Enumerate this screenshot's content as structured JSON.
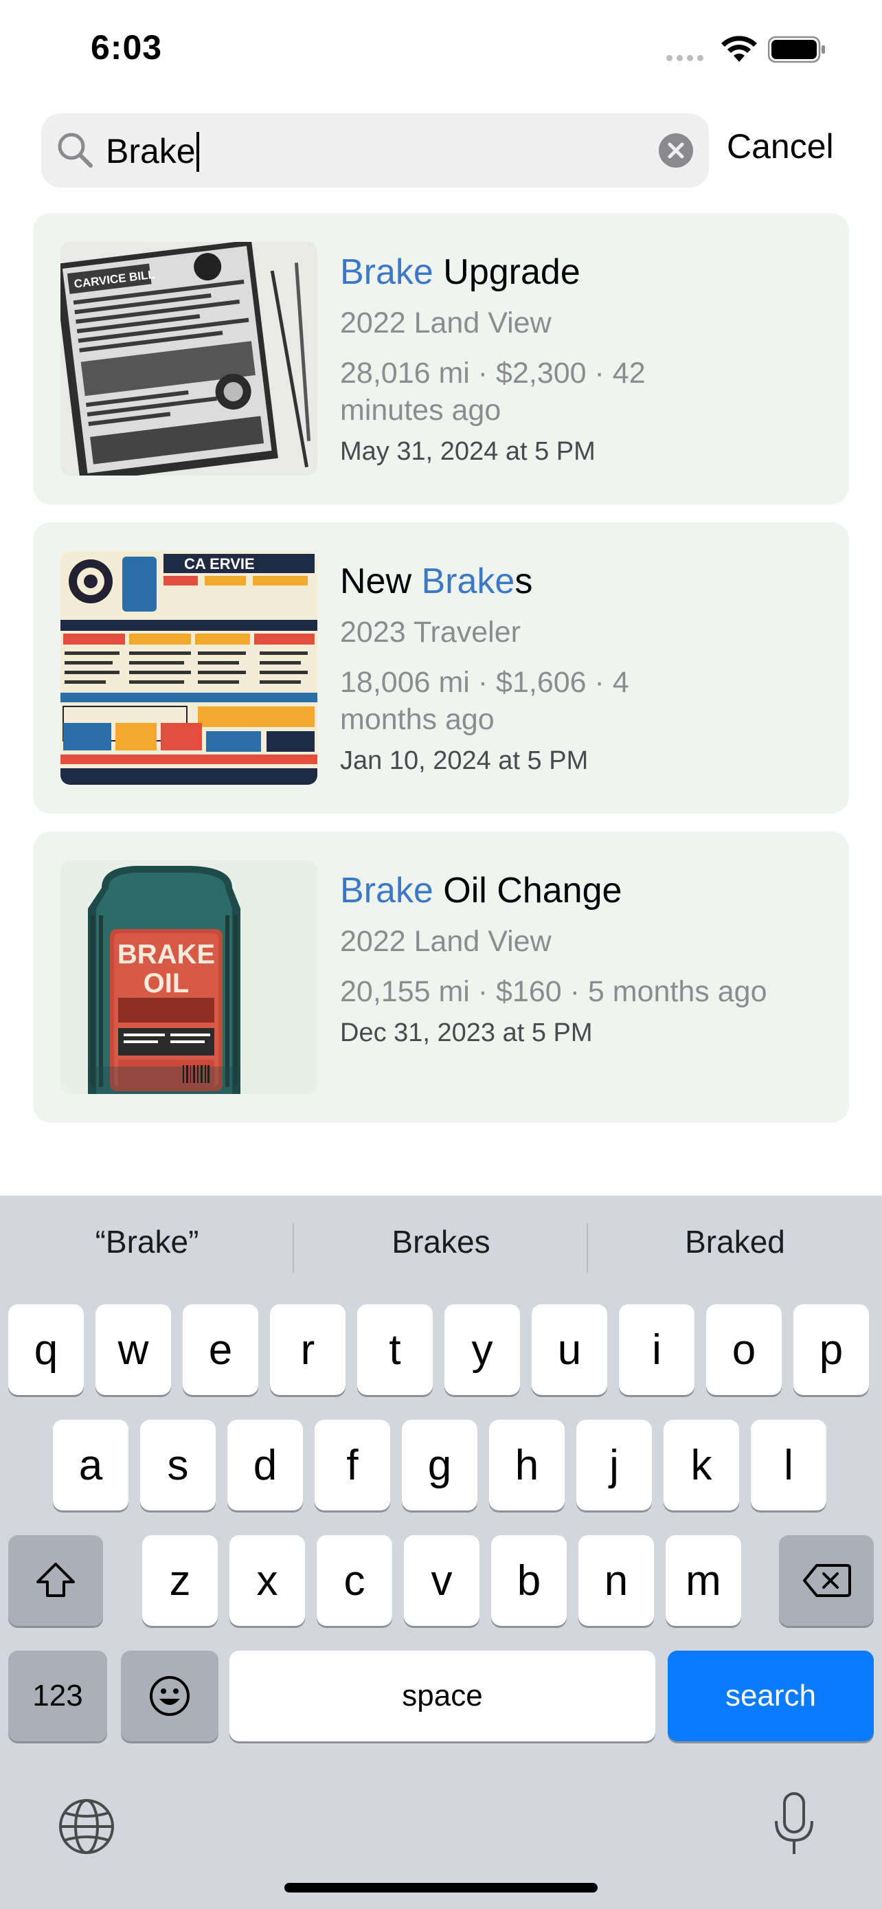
{
  "status_bar": {
    "time": "6:03"
  },
  "search": {
    "query": "Brake",
    "cancel_label": "Cancel"
  },
  "results": [
    {
      "title_highlight": "Brake",
      "title_rest": " Upgrade",
      "vehicle": "2022 Land View",
      "meta_line1": "28,016 mi · $2,300 · 42",
      "meta_line2": "minutes ago",
      "date": "May 31, 2024 at 5 PM",
      "thumb_label": "CARVICE BILL"
    },
    {
      "title_pre": "New ",
      "title_highlight": "Brake",
      "title_post": "s",
      "vehicle": "2023 Traveler",
      "meta_line1": "18,006 mi · $1,606 · 4",
      "meta_line2": "months ago",
      "date": "Jan 10, 2024 at 5 PM",
      "thumb_label": "CA ERVIE"
    },
    {
      "title_highlight": "Brake",
      "title_rest": " Oil Change",
      "vehicle": "2022 Land View",
      "meta_line1": "20,155 mi · $160 · 5 months ago",
      "date": "Dec 31, 2023 at 5 PM",
      "thumb_label_1": "BRAKE",
      "thumb_label_2": "OIL"
    }
  ],
  "keyboard": {
    "suggestions": [
      "“Brake”",
      "Brakes",
      "Braked"
    ],
    "row1": [
      "q",
      "w",
      "e",
      "r",
      "t",
      "y",
      "u",
      "i",
      "o",
      "p"
    ],
    "row2": [
      "a",
      "s",
      "d",
      "f",
      "g",
      "h",
      "j",
      "k",
      "l"
    ],
    "row3": [
      "z",
      "x",
      "c",
      "v",
      "b",
      "n",
      "m"
    ],
    "numbers_label": "123",
    "space_label": "space",
    "search_label": "search"
  },
  "colors": {
    "highlight": "#3c78c4",
    "card_bg": "#eff4f1",
    "search_key": "#0a7aff"
  }
}
